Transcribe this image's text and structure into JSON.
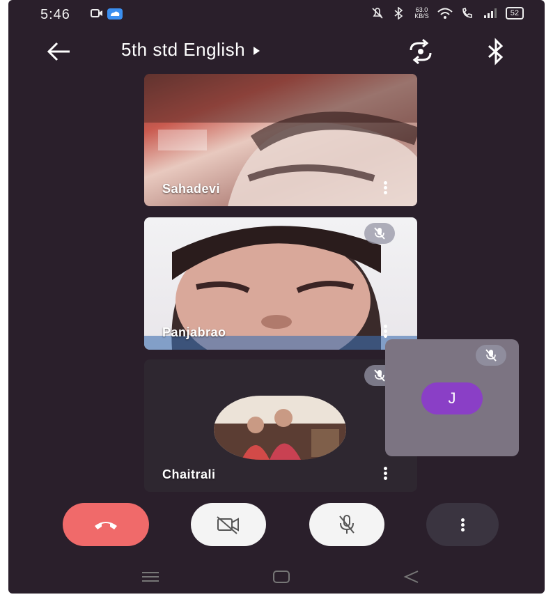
{
  "status_bar": {
    "time": "5:46",
    "net_speed_value": "63.0",
    "net_speed_unit": "KB/S",
    "battery": "52"
  },
  "app_bar": {
    "title": "5th std English"
  },
  "participants": [
    {
      "name": "Sahadevi",
      "muted": false
    },
    {
      "name": "Panjabrao",
      "muted": true
    },
    {
      "name": "Chaitrali",
      "muted": true
    }
  ],
  "self_view": {
    "initial": "J",
    "muted": true,
    "avatar_color": "#8a3fc6"
  },
  "controls": {
    "end_call_color": "#f06a6a"
  },
  "icons": [
    "back-arrow-icon",
    "play-caret-icon",
    "switch-camera-icon",
    "bluetooth-icon",
    "mic-off-icon",
    "camera-off-icon",
    "phone-end-icon",
    "more-vert-icon"
  ]
}
